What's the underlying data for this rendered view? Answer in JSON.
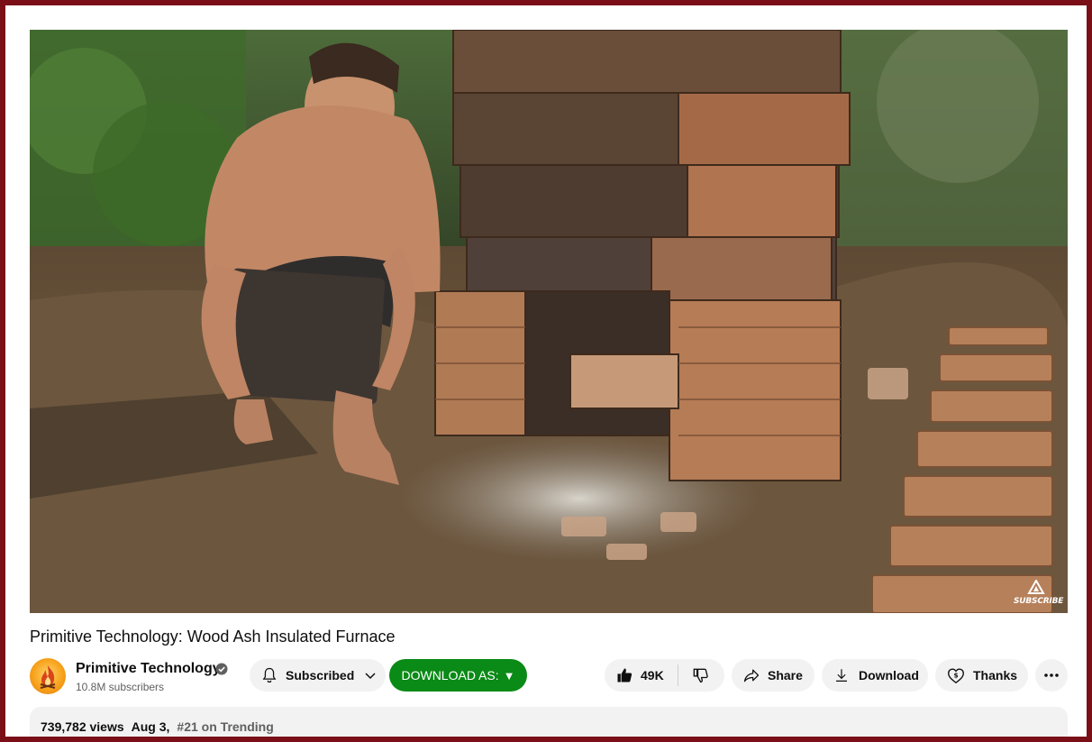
{
  "video": {
    "title": "Primitive Technology: Wood Ash Insulated Furnace",
    "watermark_text": "SUBSCRIBE",
    "watermark_icon": "subscribe-logo-icon"
  },
  "channel": {
    "name": "Primitive Technology",
    "subscribers": "10.8M subscribers",
    "avatar_icon": "fire-icon",
    "verified_icon": "verified-check-icon"
  },
  "actions": {
    "subscribed_label": "Subscribed",
    "download_as_label": "DOWNLOAD AS:",
    "download_as_arrow": "▼",
    "like_count": "49K",
    "share_label": "Share",
    "download_label": "Download",
    "thanks_label": "Thanks",
    "icons": [
      "bell-icon",
      "chevron-down-icon",
      "thumbs-up-icon",
      "thumbs-down-icon",
      "share-icon",
      "download-icon",
      "thanks-icon",
      "more-icon"
    ]
  },
  "description": {
    "views": "739,782 views",
    "date": "Aug 3,",
    "trending_rank": "#21",
    "trending_suffix": "on Trending"
  },
  "colors": {
    "border": "#7a0f18",
    "download_as_bg": "#0a8a16",
    "pill_bg": "#f2f2f2"
  }
}
